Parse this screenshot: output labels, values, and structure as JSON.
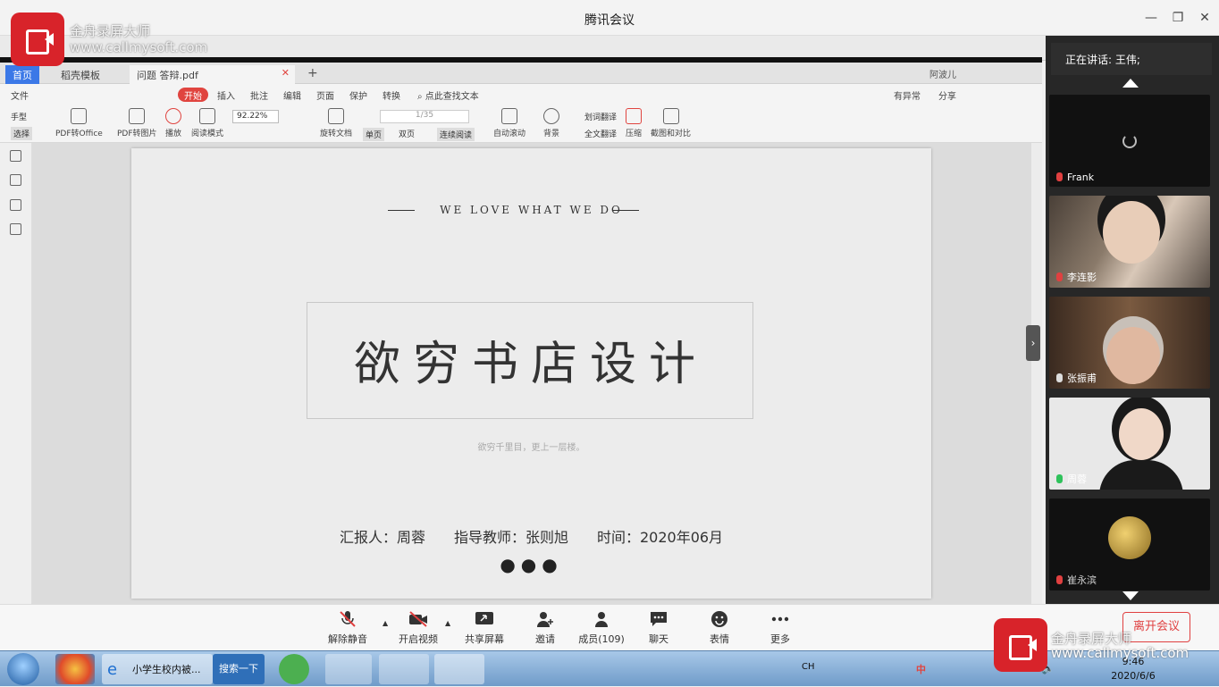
{
  "window": {
    "title": "腾讯会议"
  },
  "wps": {
    "tabs": [
      "首页",
      "稻壳模板",
      "问题 答辩.pdf"
    ],
    "user": "阿波儿",
    "menu": [
      "文件",
      "开始",
      "插入",
      "批注",
      "编辑",
      "页面",
      "保护",
      "转换",
      "点此查找文本"
    ],
    "menu_right": [
      "有异常",
      "分享"
    ],
    "tools": [
      "手型",
      "选择",
      "PDF转Office",
      "PDF转图片",
      "播放",
      "阅读模式",
      "旋转文档",
      "单页",
      "双页",
      "连续阅读",
      "自动滚动",
      "背景",
      "划词翻译",
      "全文翻译",
      "压缩",
      "截图和对比"
    ],
    "zoom": "92.22%",
    "page_indicator": "1/35"
  },
  "slide": {
    "slogan": "WE LOVE WHAT WE DO",
    "title": "欲穷书店设计",
    "subtitle": "欲穷千里目，更上一层楼。",
    "reporter": "汇报人：周蓉",
    "teacher": "指导教师：张则旭",
    "date": "时间：2020年06月",
    "dots": "●●●"
  },
  "panel": {
    "speaking": "正在讲话: 王伟;",
    "participants": [
      {
        "name": "Frank",
        "mic": "muted"
      },
      {
        "name": "李连影",
        "mic": "muted"
      },
      {
        "name": "张振甫",
        "mic": "on"
      },
      {
        "name": "周蓉",
        "mic": "live"
      },
      {
        "name": "崔永滨",
        "mic": "muted"
      }
    ]
  },
  "controls": {
    "unmute": "解除静音",
    "video": "开启视频",
    "share": "共享屏幕",
    "invite": "邀请",
    "members": "成员(109)",
    "chat": "聊天",
    "emoji": "表情",
    "more": "更多",
    "leave": "离开会议"
  },
  "taskbar": {
    "ie_item": "小学生校内被...",
    "search": "搜索一下",
    "lang": "CH",
    "time": "9:46",
    "date": "2020/6/6"
  },
  "watermark": {
    "name": "金舟录屏大师",
    "url": "www.callmysoft.com"
  },
  "colors": {
    "accent": "#e0443f",
    "panel_bg": "#272727",
    "leave": "#e04040"
  }
}
